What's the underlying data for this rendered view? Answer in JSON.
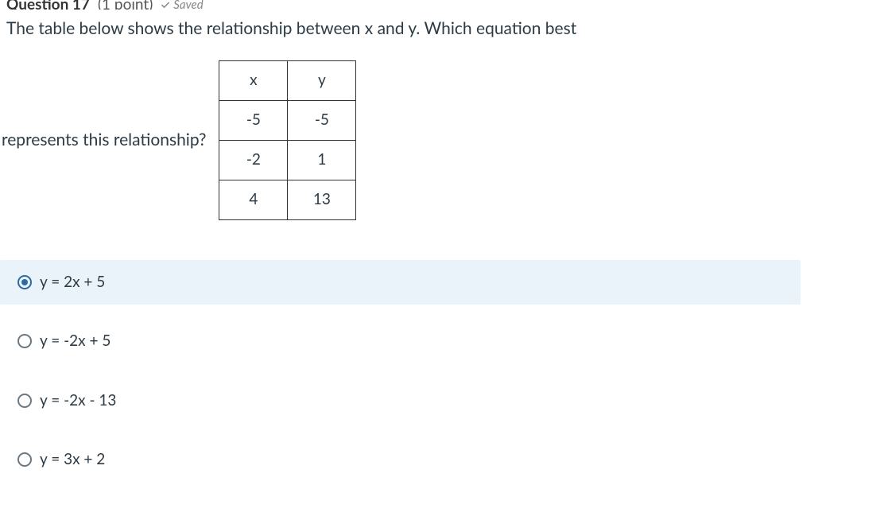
{
  "meta": {
    "question_label": "Question 17",
    "points_label": "(1 point)",
    "saved_label": "Saved"
  },
  "question": {
    "line1": "The table below shows the relationship between x and y. Which equation best",
    "line2": "represents this relationship?"
  },
  "table": {
    "headers": {
      "x": "x",
      "y": "y"
    },
    "rows": [
      {
        "x": "-5",
        "y": "-5"
      },
      {
        "x": "-2",
        "y": "1"
      },
      {
        "x": "4",
        "y": "13"
      }
    ]
  },
  "answers": {
    "options": [
      {
        "label": "y = 2x + 5",
        "selected": true
      },
      {
        "label": "y = -2x + 5",
        "selected": false
      },
      {
        "label": "y = -2x - 13",
        "selected": false
      },
      {
        "label": "y = 3x + 2",
        "selected": false
      }
    ]
  }
}
